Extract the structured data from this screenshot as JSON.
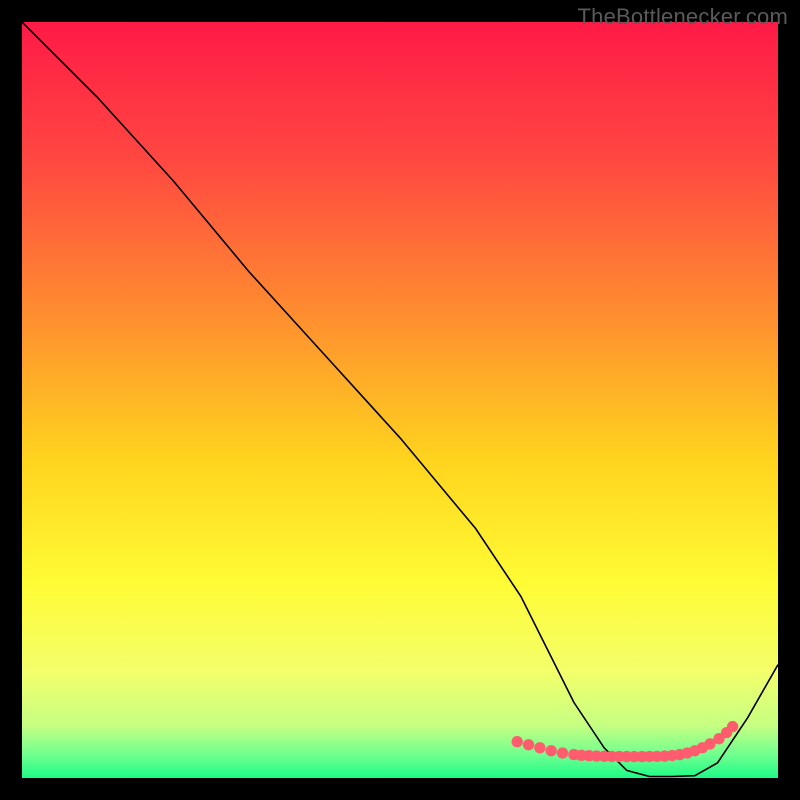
{
  "watermark": "TheBottlenecker.com",
  "chart_data": {
    "type": "line",
    "title": "",
    "xlabel": "",
    "ylabel": "",
    "xlim": [
      0,
      100
    ],
    "ylim": [
      0,
      100
    ],
    "background_gradient": [
      "#ff1a47",
      "#ff4741",
      "#ff8b30",
      "#ffd41e",
      "#fffb34",
      "#f3ff6b",
      "#c6ff82",
      "#6fff8f",
      "#1cfb87"
    ],
    "series": [
      {
        "name": "curve",
        "color": "#000000",
        "x": [
          0,
          3,
          10,
          20,
          30,
          40,
          50,
          60,
          66,
          70,
          73,
          77,
          80,
          83,
          86,
          89,
          92,
          96,
          100
        ],
        "y": [
          100,
          97,
          90,
          79,
          67,
          56,
          45,
          33,
          24,
          16,
          10,
          4,
          1,
          0.2,
          0.2,
          0.3,
          2,
          8,
          15
        ]
      }
    ],
    "highlight_points": {
      "name": "bottom-dots",
      "color": "#ff5d6e",
      "x": [
        65.5,
        67,
        68.5,
        70,
        71.5,
        73,
        74,
        75,
        76,
        77,
        78,
        79,
        80,
        81,
        82,
        83,
        84,
        85,
        86,
        87,
        88,
        89,
        90,
        91,
        92.2,
        93.2,
        94
      ],
      "y": [
        4.8,
        4.4,
        4.0,
        3.6,
        3.3,
        3.1,
        3.0,
        2.95,
        2.9,
        2.87,
        2.85,
        2.84,
        2.83,
        2.83,
        2.83,
        2.84,
        2.86,
        2.9,
        2.97,
        3.1,
        3.3,
        3.6,
        4.0,
        4.5,
        5.2,
        6.0,
        6.8
      ]
    }
  }
}
